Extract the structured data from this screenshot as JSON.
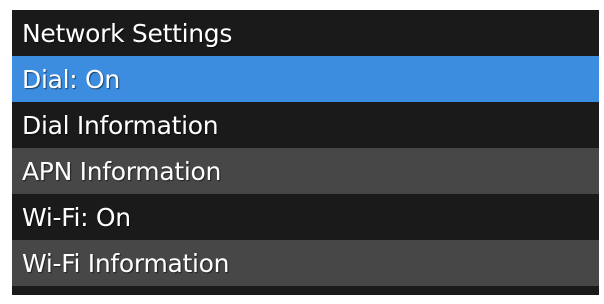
{
  "menu": {
    "title": "Network Settings",
    "items": [
      {
        "label": "Dial: On",
        "selected": true
      },
      {
        "label": "Dial Information",
        "selected": false
      },
      {
        "label": "APN Information",
        "selected": false
      },
      {
        "label": "Wi-Fi: On",
        "selected": false
      },
      {
        "label": "Wi-Fi Information",
        "selected": false
      }
    ]
  },
  "colors": {
    "background": "#1a1a1a",
    "highlight": "#3c8de0",
    "alt_row": "#474747",
    "text": "#ffffff"
  }
}
